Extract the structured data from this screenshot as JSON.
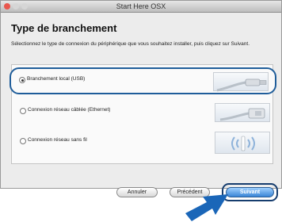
{
  "window": {
    "title": "Start Here OSX"
  },
  "heading": "Type de branchement",
  "description": "Sélectionnez le type de connexion du périphérique que vous souhaitez installer, puis cliquez sur Suivant.",
  "options": [
    {
      "label": "Branchement local (USB)",
      "selected": true
    },
    {
      "label": "Connexion réseau câblée (Ethernet)",
      "selected": false
    },
    {
      "label": "Connexion réseau sans fil",
      "selected": false
    }
  ],
  "buttons": {
    "cancel": "Annuler",
    "previous": "Précédent",
    "next": "Suivant"
  },
  "colors": {
    "highlight": "#1f5d9a",
    "pointer_arrow": "#1a66b8",
    "next_button": "#3a85d6"
  },
  "icons": [
    "usb-cable-icon",
    "ethernet-cable-icon",
    "wireless-signal-icon",
    "pointer-arrow-icon"
  ]
}
